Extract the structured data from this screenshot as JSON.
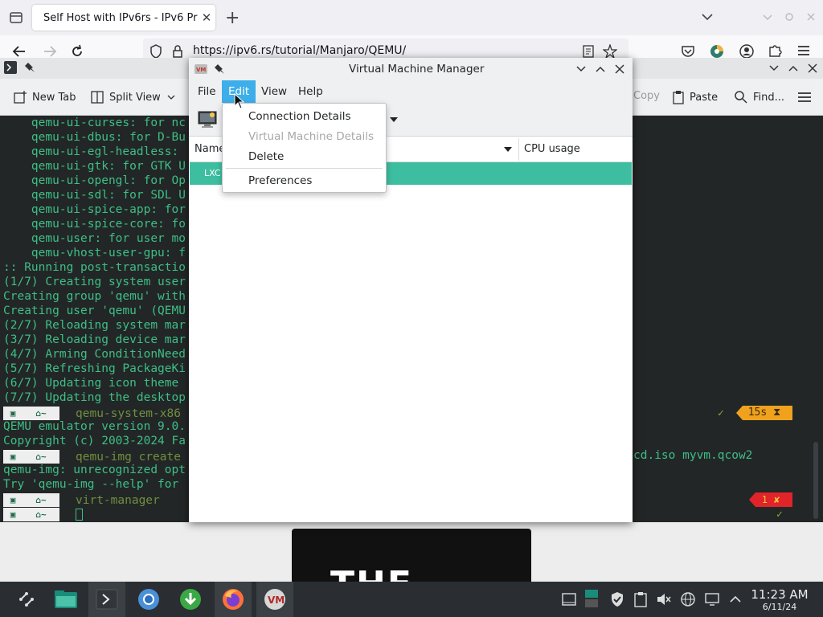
{
  "browser": {
    "tab_title": "Self Host with IPv6rs - IPv6 Pr",
    "url": "https://ipv6.rs/tutorial/Manjaro/QEMU/"
  },
  "konsole": {
    "toolbar": {
      "new_tab": "New Tab",
      "split_view": "Split View",
      "copy": "Copy",
      "paste": "Paste",
      "find": "Find..."
    },
    "terminal_lines": [
      "    qemu-ui-curses: for nc",
      "    qemu-ui-dbus: for D-Bu",
      "    qemu-ui-egl-headless: ",
      "    qemu-ui-gtk: for GTK U",
      "    qemu-ui-opengl: for Op",
      "    qemu-ui-sdl: for SDL U",
      "    qemu-ui-spice-app: for",
      "    qemu-ui-spice-core: fo",
      "    qemu-user: for user mo",
      "    qemu-vhost-user-gpu: f",
      ":: Running post-transactio",
      "(1/7) Creating system user",
      "Creating group 'qemu' with",
      "Creating user 'qemu' (QEMU",
      "(2/7) Reloading system mar",
      "(3/7) Reloading device mar",
      "(4/7) Arming ConditionNeed",
      "(5/7) Refreshing PackageKi",
      "(6/7) Updating icon theme ",
      "(7/7) Updating the desktop"
    ],
    "prompt_home": "~",
    "cmd1": "qemu-system-x86",
    "out1a": "QEMU emulator version 9.0.",
    "out1b": "Copyright (c) 2003-2024 Fa",
    "cmd2": "qemu-img create",
    "cmd2_tail": "cd.iso myvm.qcow2",
    "out2a": "qemu-img: unrecognized opt",
    "out2b": "Try 'qemu-img --help' for ",
    "cmd3": "virt-manager",
    "status_check": "✓",
    "status_time": "15s",
    "status_hourglass": "⧗",
    "status_error_code": "1",
    "status_error_x": "✘"
  },
  "vmm": {
    "title": "Virtual Machine Manager",
    "menus": [
      "File",
      "Edit",
      "View",
      "Help"
    ],
    "columns": {
      "name": "Name",
      "cpu": "CPU usage"
    },
    "row_label": "LXC"
  },
  "edit_menu": {
    "items": [
      {
        "label": "Connection Details",
        "enabled": true
      },
      {
        "label": "Virtual Machine Details",
        "enabled": false
      },
      {
        "label": "Delete",
        "enabled": true
      },
      {
        "label": "Preferences",
        "enabled": true
      }
    ]
  },
  "video": {
    "text": "THE ONLY"
  },
  "taskbar": {
    "time": "11:23 AM",
    "date": "6/11/24"
  },
  "colors": {
    "accent": "#3daee9",
    "selection_row": "#3dbea0",
    "terminal_text": "#3dbf86",
    "taskbar": "#2a2e32"
  }
}
